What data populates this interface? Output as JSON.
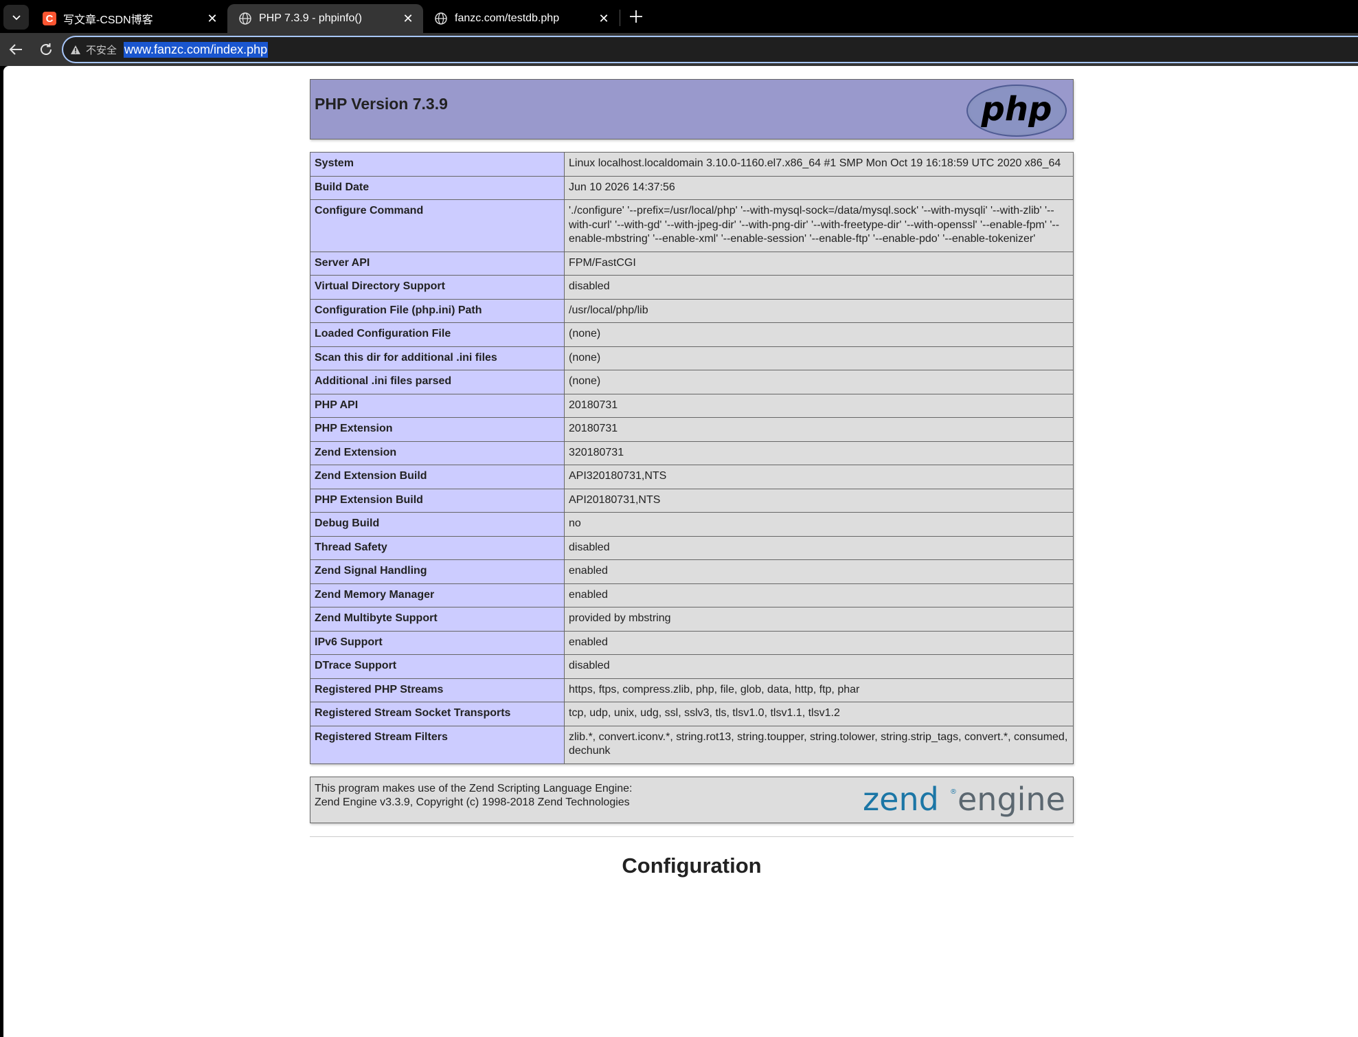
{
  "browser": {
    "tabs": [
      {
        "title": "写文章-CSDN博客",
        "favicon": "csdn-icon",
        "active": false
      },
      {
        "title": "PHP 7.3.9 - phpinfo()",
        "favicon": "globe-icon",
        "active": true
      },
      {
        "title": "fanzc.com/testdb.php",
        "favicon": "globe-icon",
        "active": false
      }
    ],
    "security_label": "不安全",
    "url": "www.fanzc.com/index.php",
    "csdn_letter": "C"
  },
  "header": {
    "title": "PHP Version 7.3.9",
    "logo_text": "php"
  },
  "info_rows": [
    {
      "key": "System",
      "value": "Linux localhost.localdomain 3.10.0-1160.el7.x86_64 #1 SMP Mon Oct 19 16:18:59 UTC 2020 x86_64"
    },
    {
      "key": "Build Date",
      "value": "Jun 10 2026 14:37:56"
    },
    {
      "key": "Configure Command",
      "value": "'./configure' '--prefix=/usr/local/php' '--with-mysql-sock=/data/mysql.sock' '--with-mysqli' '--with-zlib' '--with-curl' '--with-gd' '--with-jpeg-dir' '--with-png-dir' '--with-freetype-dir' '--with-openssl' '--enable-fpm' '--enable-mbstring' '--enable-xml' '--enable-session' '--enable-ftp' '--enable-pdo' '--enable-tokenizer'"
    },
    {
      "key": "Server API",
      "value": "FPM/FastCGI"
    },
    {
      "key": "Virtual Directory Support",
      "value": "disabled"
    },
    {
      "key": "Configuration File (php.ini) Path",
      "value": "/usr/local/php/lib"
    },
    {
      "key": "Loaded Configuration File",
      "value": "(none)"
    },
    {
      "key": "Scan this dir for additional .ini files",
      "value": "(none)"
    },
    {
      "key": "Additional .ini files parsed",
      "value": "(none)"
    },
    {
      "key": "PHP API",
      "value": "20180731"
    },
    {
      "key": "PHP Extension",
      "value": "20180731"
    },
    {
      "key": "Zend Extension",
      "value": "320180731"
    },
    {
      "key": "Zend Extension Build",
      "value": "API320180731,NTS"
    },
    {
      "key": "PHP Extension Build",
      "value": "API20180731,NTS"
    },
    {
      "key": "Debug Build",
      "value": "no"
    },
    {
      "key": "Thread Safety",
      "value": "disabled"
    },
    {
      "key": "Zend Signal Handling",
      "value": "enabled"
    },
    {
      "key": "Zend Memory Manager",
      "value": "enabled"
    },
    {
      "key": "Zend Multibyte Support",
      "value": "provided by mbstring"
    },
    {
      "key": "IPv6 Support",
      "value": "enabled"
    },
    {
      "key": "DTrace Support",
      "value": "disabled"
    },
    {
      "key": "Registered PHP Streams",
      "value": "https, ftps, compress.zlib, php, file, glob, data, http, ftp, phar"
    },
    {
      "key": "Registered Stream Socket Transports",
      "value": "tcp, udp, unix, udg, ssl, sslv3, tls, tlsv1.0, tlsv1.1, tlsv1.2"
    },
    {
      "key": "Registered Stream Filters",
      "value": "zlib.*, convert.iconv.*, string.rot13, string.toupper, string.tolower, string.strip_tags, convert.*, consumed, dechunk"
    }
  ],
  "zend": {
    "line1": "This program makes use of the Zend Scripting Language Engine:",
    "line2": "Zend Engine v3.3.9, Copyright (c) 1998-2018 Zend Technologies",
    "logo_word1": "zend",
    "logo_word2": "engine"
  },
  "section_heading": "Configuration",
  "colors": {
    "header_bg": "#9999cc",
    "key_cell_bg": "#ccccff",
    "value_cell_bg": "#dddddd",
    "url_highlight": "#1a56cf",
    "zend_blue": "#1b76a6",
    "zend_gray": "#5b6770"
  }
}
